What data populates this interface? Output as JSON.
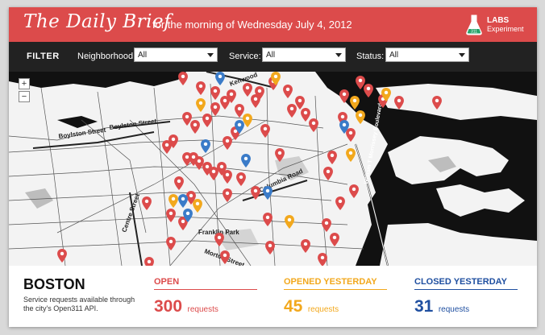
{
  "header": {
    "title": "The Daily Brief",
    "subtitle": "for the morning of Wednesday July 4, 2012",
    "badge_line1": "LABS",
    "badge_line2": "Experiment",
    "badge_icon": "flask-icon",
    "color": "#dc4b4b"
  },
  "filters": {
    "title": "FILTER",
    "neighborhood": {
      "label": "Neighborhood:",
      "value": "All"
    },
    "service": {
      "label": "Service:",
      "value": "All"
    },
    "status": {
      "label": "Status:",
      "value": "All"
    }
  },
  "map": {
    "zoom_in": "+",
    "zoom_out": "−",
    "labels": {
      "boylston1": "Boylston Street",
      "boylston2": "Boylston Street",
      "centre": "Centre Street",
      "columbia": "Columbia Road",
      "franklin": "Franklin Park",
      "morton": "Morton Street",
      "kenwood": "Kenwood",
      "morrissey": "William T Morrissey Boulevard"
    },
    "marker_colors": {
      "open": "#dc4b4b",
      "opened_yesterday": "#f2a81d",
      "closed_yesterday": "#3a7bc8"
    }
  },
  "footer": {
    "city": "BOSTON",
    "description": "Service requests available through the city's Open311 API.",
    "stats": [
      {
        "label": "OPEN",
        "value": "300",
        "unit": "requests",
        "color": "#dc4b4b"
      },
      {
        "label": "OPENED YESTERDAY",
        "value": "45",
        "unit": "requests",
        "color": "#f2a81d"
      },
      {
        "label": "CLOSED YESTERDAY",
        "value": "31",
        "unit": "requests",
        "color": "#1f4fa0"
      }
    ]
  }
}
